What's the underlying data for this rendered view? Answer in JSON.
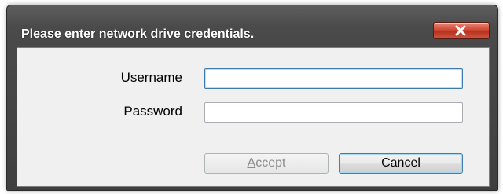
{
  "dialog": {
    "title": "Please enter network drive credentials.",
    "close_icon": "close-x-icon",
    "accent_color": "#c9422c"
  },
  "form": {
    "username_label": "Username",
    "username_value": "",
    "password_label": "Password",
    "password_value": ""
  },
  "buttons": {
    "accept_mnemonic": "A",
    "accept_rest": "ccept",
    "accept_disabled": true,
    "cancel_label": "Cancel"
  }
}
